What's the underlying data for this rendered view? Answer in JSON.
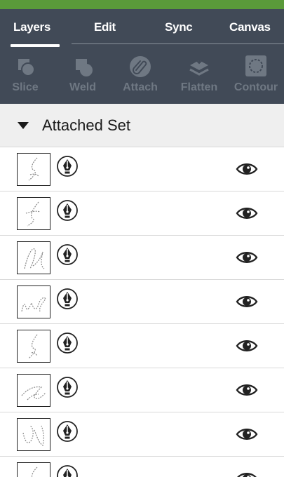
{
  "tabs": [
    {
      "label": "Layers",
      "active": true
    },
    {
      "label": "Edit",
      "active": false
    },
    {
      "label": "Sync",
      "active": false
    },
    {
      "label": "Canvas",
      "active": false
    }
  ],
  "tools": [
    {
      "label": "Slice",
      "icon": "slice-icon"
    },
    {
      "label": "Weld",
      "icon": "weld-icon"
    },
    {
      "label": "Attach",
      "icon": "attach-icon"
    },
    {
      "label": "Flatten",
      "icon": "flatten-icon"
    },
    {
      "label": "Contour",
      "icon": "contour-icon"
    }
  ],
  "set": {
    "title": "Attached Set",
    "expanded": true
  },
  "layers": [
    {
      "thumb": "handwritten-letter-thumbnail",
      "visible": true
    },
    {
      "thumb": "handwritten-letter-thumbnail",
      "visible": true
    },
    {
      "thumb": "handwritten-letter-thumbnail",
      "visible": true
    },
    {
      "thumb": "handwritten-letter-thumbnail",
      "visible": true
    },
    {
      "thumb": "handwritten-letter-thumbnail",
      "visible": true
    },
    {
      "thumb": "handwritten-letter-thumbnail",
      "visible": true
    },
    {
      "thumb": "handwritten-letter-thumbnail",
      "visible": true
    },
    {
      "thumb": "handwritten-letter-thumbnail",
      "visible": true
    }
  ],
  "colors": {
    "accent": "#5a9a3a",
    "header": "#414a57",
    "disabled_tool": "#6f7883"
  }
}
